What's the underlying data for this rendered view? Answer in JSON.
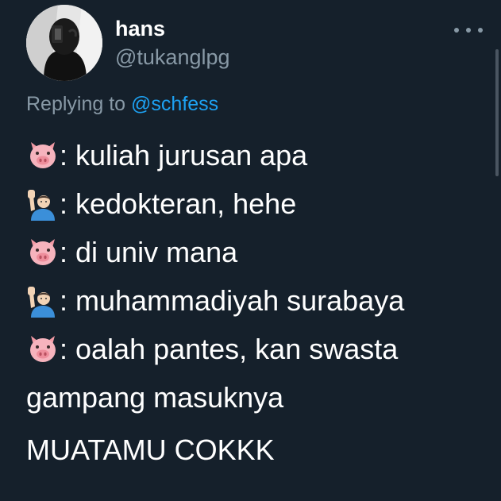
{
  "author": {
    "name": "hans",
    "handle": "@tukanglpg"
  },
  "reply": {
    "prefix": "Replying to ",
    "to": "@schfess"
  },
  "lines": [
    {
      "speaker": "pig-face-icon",
      "text": ": kuliah jurusan apa"
    },
    {
      "speaker": "person-raising-hand-icon",
      "text": ": kedokteran, hehe"
    },
    {
      "speaker": "pig-face-icon",
      "text": ": di univ mana"
    },
    {
      "speaker": "person-raising-hand-icon",
      "text": ": muhammadiyah surabaya"
    },
    {
      "speaker": "pig-face-icon",
      "text": ": oalah pantes, kan swasta"
    }
  ],
  "continuation": "gampang masuknya",
  "closing": "MUATAMU COKKK",
  "colors": {
    "background": "#15202b",
    "primary_text": "#ffffff",
    "secondary_text": "#8899a6",
    "link": "#1da1f2"
  }
}
